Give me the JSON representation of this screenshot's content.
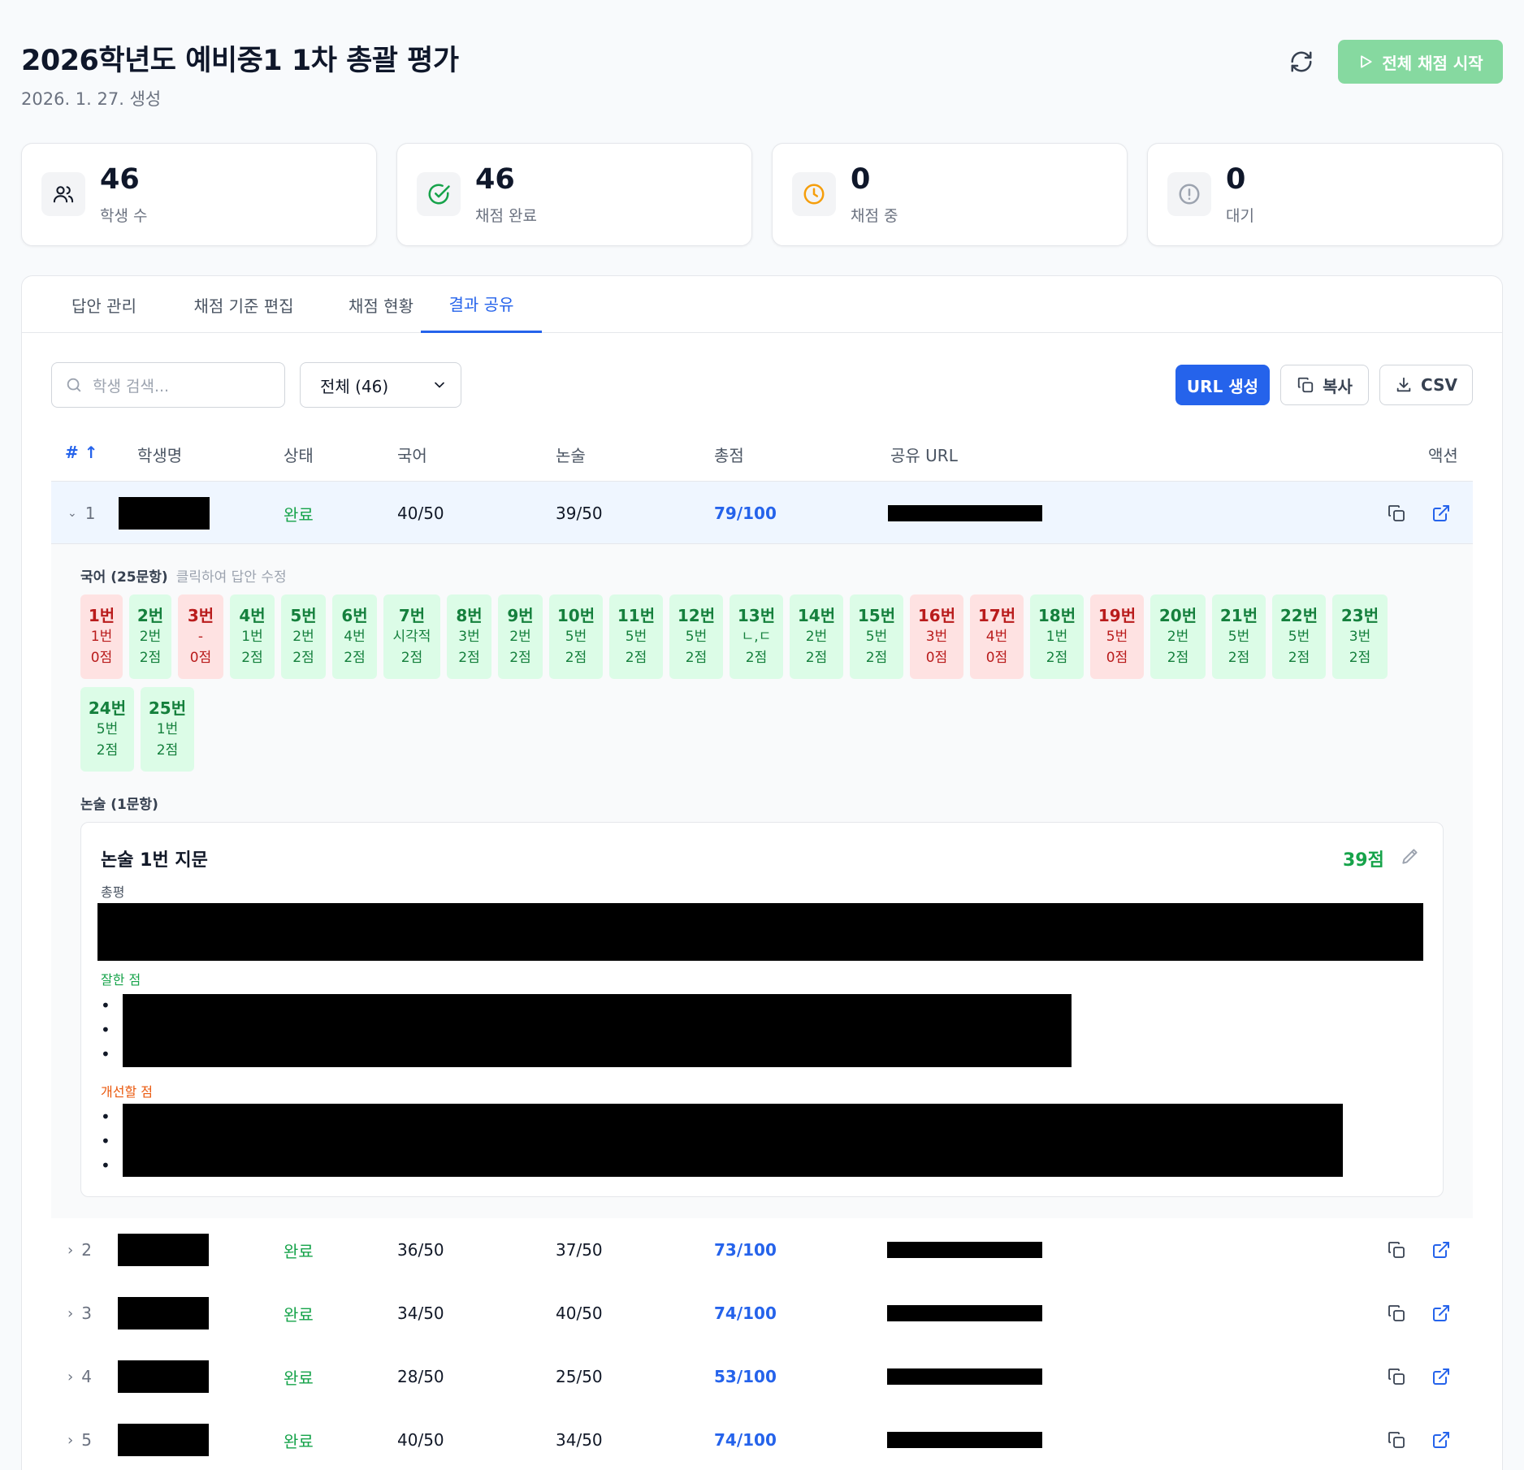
{
  "header": {
    "title": "2026학년도 예비중1 1차 총괄 평가",
    "created": "2026. 1. 27. 생성",
    "start_button": "전체 채점 시작"
  },
  "stats": [
    {
      "value": "46",
      "label": "학생 수",
      "icon": "users-icon"
    },
    {
      "value": "46",
      "label": "채점 완료",
      "icon": "check-circle-icon"
    },
    {
      "value": "0",
      "label": "채점 중",
      "icon": "clock-icon"
    },
    {
      "value": "0",
      "label": "대기",
      "icon": "alert-circle-icon"
    }
  ],
  "colors": {
    "accent": "#2563eb",
    "success": "#16a34a",
    "danger": "#dc2626",
    "warning": "#f59e0b",
    "start_button": "#86d9a0"
  },
  "tabs": [
    {
      "label": "답안 관리",
      "active": false
    },
    {
      "label": "채점 기준 편집",
      "active": false
    },
    {
      "label": "채점 현황",
      "active": false
    },
    {
      "label": "결과 공유",
      "active": true
    }
  ],
  "toolbar": {
    "search_placeholder": "학생 검색...",
    "filter_value": "전체 (46)",
    "url_button": "URL 생성",
    "copy_button": "복사",
    "csv_button": "CSV"
  },
  "table": {
    "headers": {
      "num": "#",
      "name": "학생명",
      "status": "상태",
      "korean": "국어",
      "essay": "논술",
      "total": "총점",
      "url": "공유 URL",
      "action": "액션"
    },
    "rows": [
      {
        "num": "1",
        "status": "완료",
        "korean": "40/50",
        "essay": "39/50",
        "total": "79/100",
        "expanded": true
      },
      {
        "num": "2",
        "status": "완료",
        "korean": "36/50",
        "essay": "37/50",
        "total": "73/100",
        "expanded": false
      },
      {
        "num": "3",
        "status": "완료",
        "korean": "34/50",
        "essay": "40/50",
        "total": "74/100",
        "expanded": false
      },
      {
        "num": "4",
        "status": "완료",
        "korean": "28/50",
        "essay": "25/50",
        "total": "53/100",
        "expanded": false
      },
      {
        "num": "5",
        "status": "완료",
        "korean": "40/50",
        "essay": "34/50",
        "total": "74/100",
        "expanded": false
      }
    ]
  },
  "detail": {
    "korean_label": "국어 (25문항)",
    "korean_hint": "클릭하여 답안 수정",
    "questions": [
      {
        "q": "1번",
        "a": "1번",
        "s": "0점",
        "correct": false
      },
      {
        "q": "2번",
        "a": "2번",
        "s": "2점",
        "correct": true
      },
      {
        "q": "3번",
        "a": "-",
        "s": "0점",
        "correct": false
      },
      {
        "q": "4번",
        "a": "1번",
        "s": "2점",
        "correct": true
      },
      {
        "q": "5번",
        "a": "2번",
        "s": "2점",
        "correct": true
      },
      {
        "q": "6번",
        "a": "4번",
        "s": "2점",
        "correct": true
      },
      {
        "q": "7번",
        "a": "시각적",
        "s": "2점",
        "correct": true
      },
      {
        "q": "8번",
        "a": "3번",
        "s": "2점",
        "correct": true
      },
      {
        "q": "9번",
        "a": "2번",
        "s": "2점",
        "correct": true
      },
      {
        "q": "10번",
        "a": "5번",
        "s": "2점",
        "correct": true
      },
      {
        "q": "11번",
        "a": "5번",
        "s": "2점",
        "correct": true
      },
      {
        "q": "12번",
        "a": "5번",
        "s": "2점",
        "correct": true
      },
      {
        "q": "13번",
        "a": "ㄴ,ㄷ",
        "s": "2점",
        "correct": true
      },
      {
        "q": "14번",
        "a": "2번",
        "s": "2점",
        "correct": true
      },
      {
        "q": "15번",
        "a": "5번",
        "s": "2점",
        "correct": true
      },
      {
        "q": "16번",
        "a": "3번",
        "s": "0점",
        "correct": false
      },
      {
        "q": "17번",
        "a": "4번",
        "s": "0점",
        "correct": false
      },
      {
        "q": "18번",
        "a": "1번",
        "s": "2점",
        "correct": true
      },
      {
        "q": "19번",
        "a": "5번",
        "s": "0점",
        "correct": false
      },
      {
        "q": "20번",
        "a": "2번",
        "s": "2점",
        "correct": true
      },
      {
        "q": "21번",
        "a": "5번",
        "s": "2점",
        "correct": true
      },
      {
        "q": "22번",
        "a": "5번",
        "s": "2점",
        "correct": true
      },
      {
        "q": "23번",
        "a": "3번",
        "s": "2점",
        "correct": true
      },
      {
        "q": "24번",
        "a": "5번",
        "s": "2점",
        "correct": true
      },
      {
        "q": "25번",
        "a": "1번",
        "s": "2점",
        "correct": true
      }
    ],
    "essay_label": "논술 (1문항)",
    "essay_title": "논술 1번 지문",
    "essay_score": "39점",
    "overall_label": "총평",
    "strengths_label": "잘한 점",
    "improve_label": "개선할 점"
  }
}
